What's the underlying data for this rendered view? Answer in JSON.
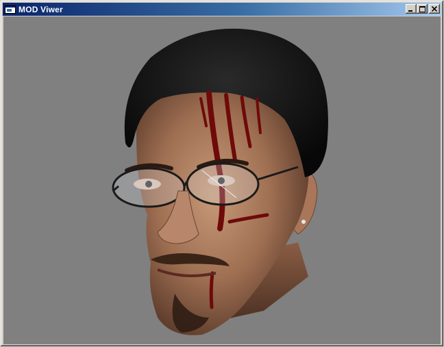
{
  "window": {
    "title": "MOD Viwer",
    "icon": "app-window-icon",
    "buttons": {
      "minimize": "minimize-icon",
      "maximize": "maximize-icon",
      "close": "close-icon"
    }
  },
  "viewport": {
    "background_color": "#808080",
    "content": "3d-head-model"
  },
  "colors": {
    "titlebar_start": "#0a246a",
    "titlebar_end": "#a6caf0",
    "chrome": "#d4d0c8"
  }
}
